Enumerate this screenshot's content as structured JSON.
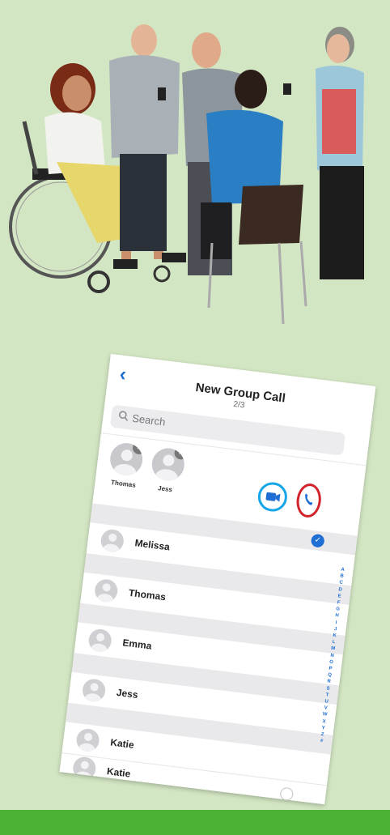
{
  "phone": {
    "back_icon": "chevron-left-icon",
    "title": "New Group Call",
    "count": "2/3",
    "search_placeholder": "Search",
    "selected": [
      {
        "name": "Thomas"
      },
      {
        "name": "Jess"
      }
    ],
    "contacts": [
      {
        "name": "Melissa",
        "checked": null
      },
      {
        "name": "Thomas",
        "checked": true
      },
      {
        "name": "Emma",
        "checked": false
      },
      {
        "name": "Jess",
        "checked": true
      },
      {
        "name": "Katie",
        "checked": false
      },
      {
        "name": "Katie",
        "checked": false
      }
    ],
    "index_letters": "ABCDEFGHIJKLMNOPQRSTUVWXYZ#"
  },
  "colors": {
    "background": "#d3e6c3",
    "bottom_bar": "#4bb234",
    "ios_blue": "#1f6ed4",
    "video_highlight": "#17a6e8",
    "call_highlight": "#d2232a"
  }
}
